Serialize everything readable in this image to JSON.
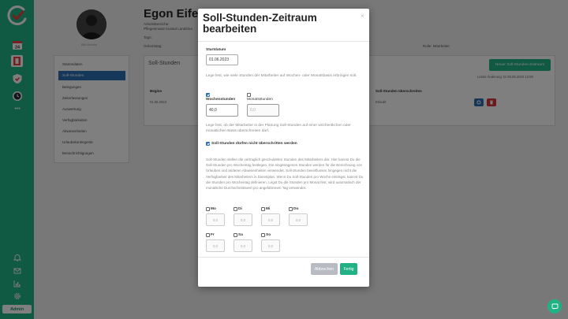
{
  "sidebar": {
    "calendar_day": "24",
    "more": "•••",
    "admin_label": "Admin"
  },
  "profile": {
    "name": "Egon Eifer",
    "line1": "Arbeitsbereiche:",
    "line2": "Pflegeeinsatz trusted Landshut",
    "tags_label": "Tags:",
    "birthday_label": "Geburtstag:",
    "avatar_caption": "Bild ändern",
    "role": "Rolle: Mitarbeiter"
  },
  "menu": {
    "items": [
      "Stammdaten",
      "Soll-Stunden",
      "Belegungen",
      "Zeiterfassungen",
      "Auswertung",
      "Verfügbarkeiten",
      "Abwesenheiten",
      "Urlaubskontingente",
      "Benachrichtigungen"
    ],
    "active": "Soll-Stunden"
  },
  "content": {
    "title": "Soll-Stunden",
    "new_button": "Neuer Soll-Stunden-Zeitraum",
    "last_change": "Letzte Änderung: Di 06.06.2023 12:06",
    "col_begin": "Beginn",
    "col_overtime": "Soll-Stunden überschreiten",
    "row_begin": "01.06.2023",
    "row_overtime": "Erlaubt"
  },
  "modal": {
    "title": "Soll-Stunden-Zeitraum bearbeiten",
    "close": "×",
    "start_label": "Startdatum",
    "start_value": "01.06.2023",
    "basis_help": "Lege fest, wie viele Stunden der Mitarbeiter auf Wochen- oder Monatsbasis erbringen soll.",
    "weekly_label": "Wochenstunden",
    "weekly_value": "40,0",
    "monthly_label": "Monatsstunden",
    "monthly_placeholder": "0,0",
    "exceed_help": "Lege fest, ob der Mitarbeiter in der Planung Soll-Stunden auf einer wöchentlichen oder monatlichen Basis überschreiten darf.",
    "exceed_label": "Soll-Stunden dürfen nicht überschritten werden",
    "info_text": "Soll-Stunden stellen die vertraglich geschuldeten Stunden des Mitarbeiters dar. Hier kannst Du die Soll-Stunden pro Wochentag festlegen. Die eingetragenen Stunden werden für die Berechnung von Urlauben und anderen Abwesenheiten verwendet. Soll-Stunden beeinflussen hingegen nicht die Verfügbarkeit des Mitarbeiters in Dienstplan. Wenn Du Soll-Stunden pro Woche einträgst, kannst Du die Stunden pro Wochentag definieren. Legst Du die Stunden pro Monat fest, wird automatisch der monatliche Durchschnittswert pro angefahrenen Tag verwendet.",
    "days": [
      {
        "label": "Mo",
        "placeholder": "0,0"
      },
      {
        "label": "Di",
        "placeholder": "0,0"
      },
      {
        "label": "Mi",
        "placeholder": "0,0"
      },
      {
        "label": "Do",
        "placeholder": "0,0"
      },
      {
        "label": "Fr",
        "placeholder": "0,0"
      },
      {
        "label": "Sa",
        "placeholder": "0,0"
      },
      {
        "label": "So",
        "placeholder": "0,0"
      }
    ],
    "cancel_label": "Abbrechen",
    "done_label": "Fertig"
  },
  "colors": {
    "brand": "#20b284",
    "primary": "#2a6fb3",
    "danger": "#d9343a"
  }
}
